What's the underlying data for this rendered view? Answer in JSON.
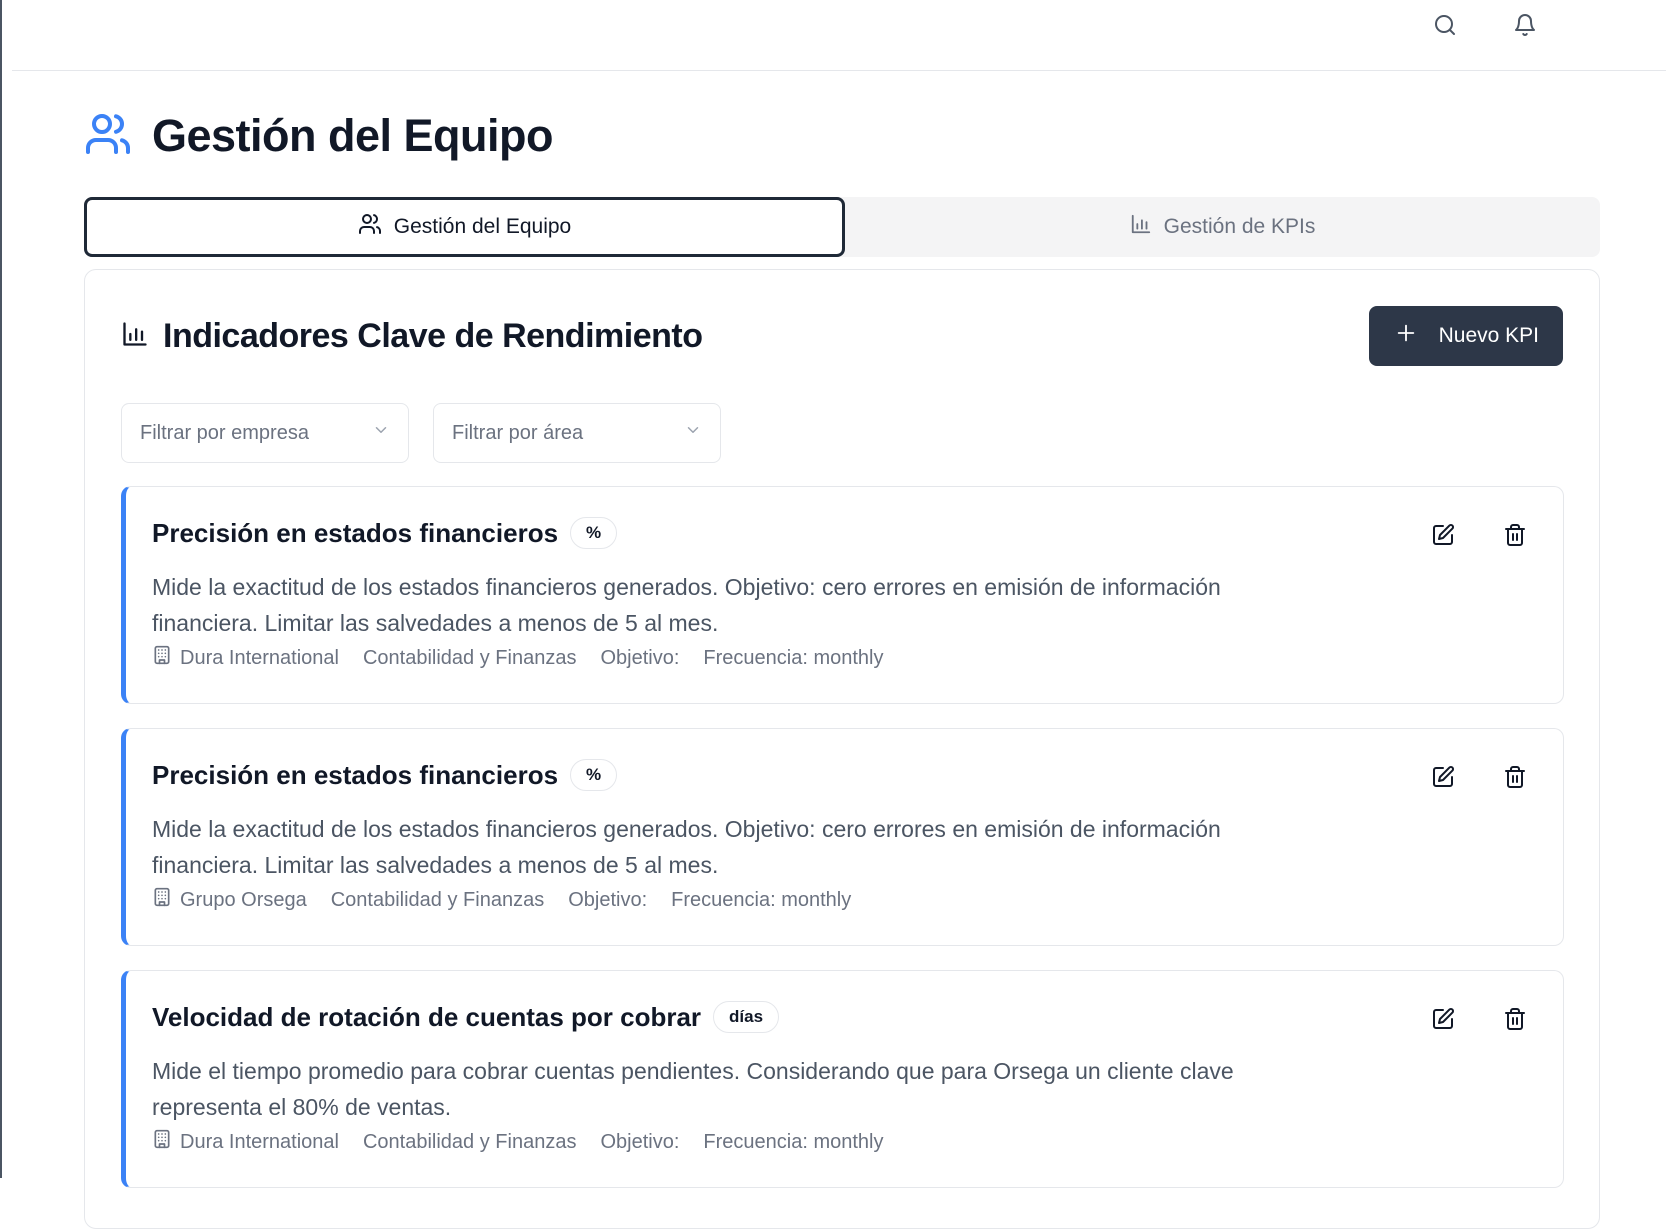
{
  "page": {
    "title": "Gestión del Equipo",
    "title_icon": "users-icon"
  },
  "topbar": {
    "search_icon": "search-icon",
    "notifications_icon": "bell-icon"
  },
  "tabs": [
    {
      "label": "Gestión del Equipo",
      "icon": "users-icon",
      "active": true
    },
    {
      "label": "Gestión de KPIs",
      "icon": "bar-chart-icon",
      "active": false
    }
  ],
  "panel": {
    "title": "Indicadores Clave de Rendimiento",
    "title_icon": "bar-chart-icon",
    "new_button_label": "Nuevo KPI"
  },
  "filters": {
    "company_placeholder": "Filtrar por empresa",
    "area_placeholder": "Filtrar por área"
  },
  "kpis": [
    {
      "title": "Precisión en estados financieros",
      "unit": "%",
      "description": "Mide la exactitud de los estados financieros generados. Objetivo: cero errores en emisión de información financiera. Limitar las salvedades a menos de 5 al mes.",
      "company": "Dura International",
      "area": "Contabilidad y Finanzas",
      "objective": "Objetivo:",
      "frequency": "Frecuencia: monthly"
    },
    {
      "title": "Precisión en estados financieros",
      "unit": "%",
      "description": "Mide la exactitud de los estados financieros generados. Objetivo: cero errores en emisión de información financiera. Limitar las salvedades a menos de 5 al mes.",
      "company": "Grupo Orsega",
      "area": "Contabilidad y Finanzas",
      "objective": "Objetivo:",
      "frequency": "Frecuencia: monthly"
    },
    {
      "title": "Velocidad de rotación de cuentas por cobrar",
      "unit": "días",
      "description": "Mide el tiempo promedio para cobrar cuentas pendientes. Considerando que para Orsega un cliente clave representa el 80% de ventas.",
      "company": "Dura International",
      "area": "Contabilidad y Finanzas",
      "objective": "Objetivo:",
      "frequency": "Frecuencia: monthly"
    }
  ],
  "colors": {
    "accent": "#3b82f6",
    "primary_button": "#2d3748",
    "text_muted": "#6b7280"
  }
}
